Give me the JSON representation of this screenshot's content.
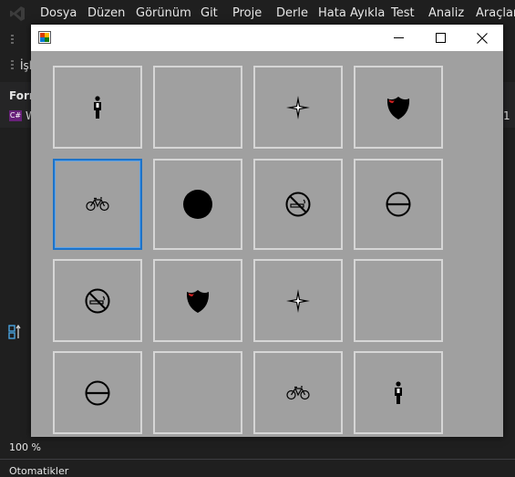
{
  "menu": {
    "items": [
      "Dosya",
      "Düzen",
      "Görünüm",
      "Git",
      "Proje",
      "Derle",
      "Hata Ayıkla",
      "Test",
      "Analiz",
      "Araçlar"
    ]
  },
  "background": {
    "toolbar_text": "İşl",
    "doc_tab_text": "Forr",
    "solution_item_text": "W",
    "right_fragment": "1",
    "zoom_text": "100 %",
    "bottom_tab": "Otomatikler"
  },
  "form": {
    "window_controls": {
      "minimize": "—",
      "maximize": "☐",
      "close": "✕"
    },
    "tiles": [
      {
        "icon": "person"
      },
      {
        "icon": "none"
      },
      {
        "icon": "compass-star"
      },
      {
        "icon": "shield"
      },
      {
        "icon": "bicycle",
        "focused": true
      },
      {
        "icon": "filled-circle"
      },
      {
        "icon": "no-smoking"
      },
      {
        "icon": "no-entry"
      },
      {
        "icon": "no-smoking"
      },
      {
        "icon": "shield"
      },
      {
        "icon": "compass-star"
      },
      {
        "icon": "none"
      },
      {
        "icon": "no-entry"
      },
      {
        "icon": "none"
      },
      {
        "icon": "bicycle"
      },
      {
        "icon": "person"
      }
    ]
  },
  "colors": {
    "ide_bg": "#1f1f1f",
    "form_bg": "#a0a0a0",
    "tile_border": "#d6d6d6",
    "focus_border": "#1e73c8"
  }
}
